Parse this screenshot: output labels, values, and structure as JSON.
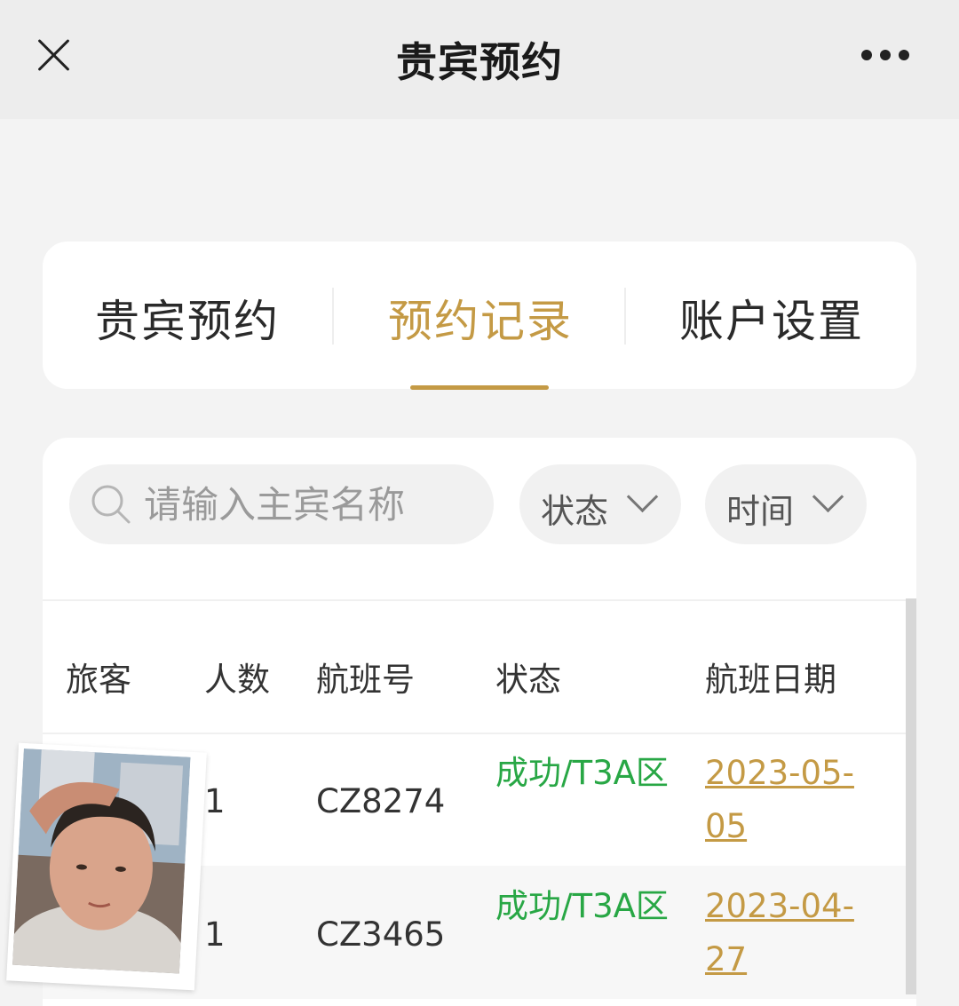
{
  "topbar": {
    "title": "贵宾预约"
  },
  "tabs": [
    {
      "label": "贵宾预约",
      "active": false
    },
    {
      "label": "预约记录",
      "active": true
    },
    {
      "label": "账户设置",
      "active": false
    }
  ],
  "search": {
    "placeholder": "请输入主宾名称"
  },
  "filters": {
    "status": "状态",
    "time": "时间"
  },
  "table": {
    "headers": [
      "旅客",
      "人数",
      "航班号",
      "状态",
      "航班日期"
    ],
    "rows": [
      {
        "passenger": "",
        "count": "1",
        "flight": "CZ8274",
        "status": "成功/T3A区",
        "date": "2023-05-05"
      },
      {
        "passenger": "",
        "count": "1",
        "flight": "CZ3465",
        "status": "成功/T3A区",
        "date": "2023-04-27"
      }
    ]
  },
  "colors": {
    "accent": "#c49a45",
    "success": "#28a745"
  }
}
